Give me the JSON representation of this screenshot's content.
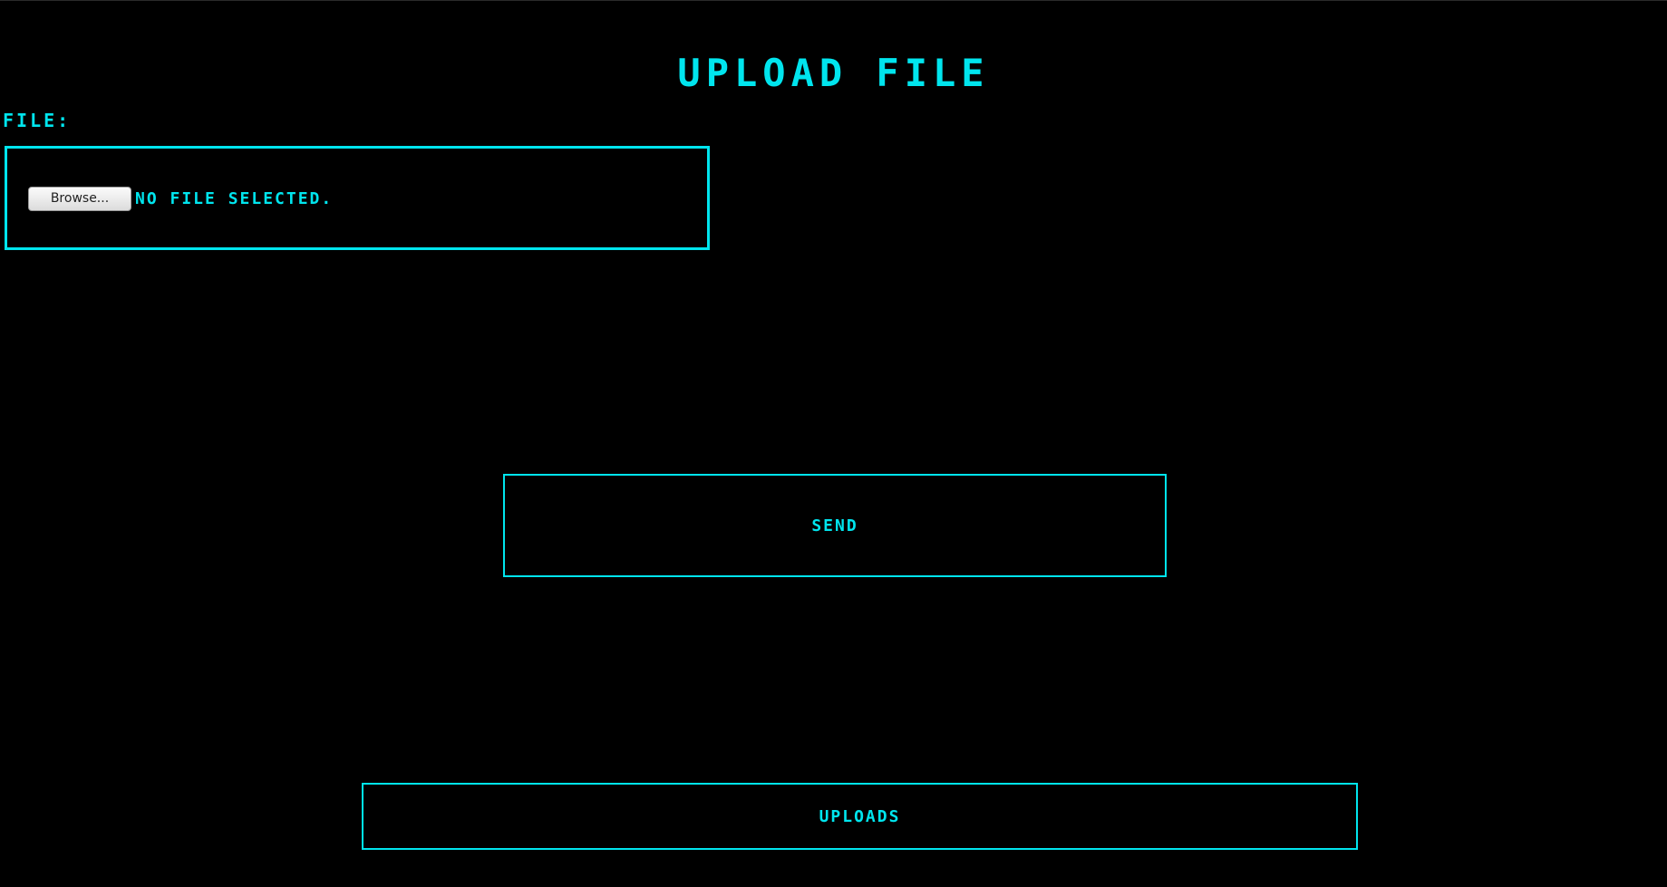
{
  "page": {
    "title": "UPLOAD FILE",
    "accent_color": "#00e5ee",
    "background_color": "#000000"
  },
  "form": {
    "file_label": "FILE:",
    "browse_label": "Browse...",
    "file_status": "NO FILE SELECTED.",
    "send_label": "SEND"
  },
  "nav": {
    "uploads_label": "UPLOADS"
  }
}
